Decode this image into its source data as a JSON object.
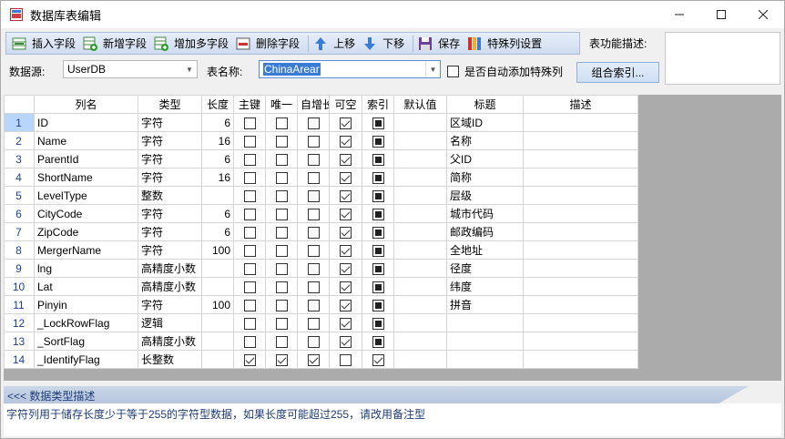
{
  "window": {
    "title": "数据库表编辑"
  },
  "toolbar": {
    "items": [
      {
        "label": "插入字段"
      },
      {
        "label": "新增字段"
      },
      {
        "label": "增加多字段"
      },
      {
        "label": "删除字段"
      },
      {
        "label": "上移"
      },
      {
        "label": "下移"
      },
      {
        "label": "保存"
      },
      {
        "label": "特殊列设置"
      }
    ],
    "table_desc_label": "表功能描述:"
  },
  "form": {
    "datasource_label": "数据源:",
    "datasource_value": "UserDB",
    "tablename_label": "表名称:",
    "tablename_value": "ChinaArear",
    "auto_special_label": "是否自动添加特殊列",
    "index_button": "组合索引..."
  },
  "grid": {
    "columns": [
      "列名",
      "类型",
      "长度",
      "主键",
      "唯一",
      "自增长",
      "可空",
      "索引",
      "默认值",
      "标题",
      "描述"
    ],
    "rows": [
      {
        "n": "1",
        "name": "ID",
        "type": "字符",
        "len": "6",
        "pk": false,
        "uq": false,
        "ai": false,
        "nul": true,
        "idx": "ind",
        "def": "",
        "title": "区域ID",
        "desc": ""
      },
      {
        "n": "2",
        "name": "Name",
        "type": "字符",
        "len": "16",
        "pk": false,
        "uq": false,
        "ai": false,
        "nul": true,
        "idx": "ind",
        "def": "",
        "title": "名称",
        "desc": ""
      },
      {
        "n": "3",
        "name": "ParentId",
        "type": "字符",
        "len": "6",
        "pk": false,
        "uq": false,
        "ai": false,
        "nul": true,
        "idx": "ind",
        "def": "",
        "title": "父ID",
        "desc": ""
      },
      {
        "n": "4",
        "name": "ShortName",
        "type": "字符",
        "len": "16",
        "pk": false,
        "uq": false,
        "ai": false,
        "nul": true,
        "idx": "ind",
        "def": "",
        "title": "简称",
        "desc": ""
      },
      {
        "n": "5",
        "name": "LevelType",
        "type": "整数",
        "len": "",
        "pk": false,
        "uq": false,
        "ai": false,
        "nul": true,
        "idx": "ind",
        "def": "",
        "title": "层级",
        "desc": ""
      },
      {
        "n": "6",
        "name": "CityCode",
        "type": "字符",
        "len": "6",
        "pk": false,
        "uq": false,
        "ai": false,
        "nul": true,
        "idx": "ind",
        "def": "",
        "title": "城市代码",
        "desc": ""
      },
      {
        "n": "7",
        "name": "ZipCode",
        "type": "字符",
        "len": "6",
        "pk": false,
        "uq": false,
        "ai": false,
        "nul": true,
        "idx": "ind",
        "def": "",
        "title": "邮政编码",
        "desc": ""
      },
      {
        "n": "8",
        "name": "MergerName",
        "type": "字符",
        "len": "100",
        "pk": false,
        "uq": false,
        "ai": false,
        "nul": true,
        "idx": "ind",
        "def": "",
        "title": "全地址",
        "desc": ""
      },
      {
        "n": "9",
        "name": "lng",
        "type": "高精度小数",
        "len": "",
        "pk": false,
        "uq": false,
        "ai": false,
        "nul": true,
        "idx": "ind",
        "def": "",
        "title": "径度",
        "desc": ""
      },
      {
        "n": "10",
        "name": "Lat",
        "type": "高精度小数",
        "len": "",
        "pk": false,
        "uq": false,
        "ai": false,
        "nul": true,
        "idx": "ind",
        "def": "",
        "title": "纬度",
        "desc": ""
      },
      {
        "n": "11",
        "name": "Pinyin",
        "type": "字符",
        "len": "100",
        "pk": false,
        "uq": false,
        "ai": false,
        "nul": true,
        "idx": "ind",
        "def": "",
        "title": "拼音",
        "desc": ""
      },
      {
        "n": "12",
        "name": "_LockRowFlag",
        "type": "逻辑",
        "len": "",
        "pk": false,
        "uq": false,
        "ai": false,
        "nul": true,
        "idx": "ind",
        "def": "",
        "title": "",
        "desc": ""
      },
      {
        "n": "13",
        "name": "_SortFlag",
        "type": "高精度小数",
        "len": "",
        "pk": false,
        "uq": false,
        "ai": false,
        "nul": true,
        "idx": "ind",
        "def": "",
        "title": "",
        "desc": ""
      },
      {
        "n": "14",
        "name": "_IdentifyFlag",
        "type": "长整数",
        "len": "",
        "pk": true,
        "uq": true,
        "ai": true,
        "nul": false,
        "idx": "on",
        "def": "",
        "title": "",
        "desc": ""
      }
    ]
  },
  "description": {
    "header": "<<< 数据类型描述",
    "text": "字符列用于储存长度少于等于255的字符型数据，如果长度可能超过255，请改用备注型"
  },
  "colors": {
    "accent": "#3a7bd5",
    "toolbar_border": "#a9bcd8",
    "desc_text": "#1e3c78"
  }
}
